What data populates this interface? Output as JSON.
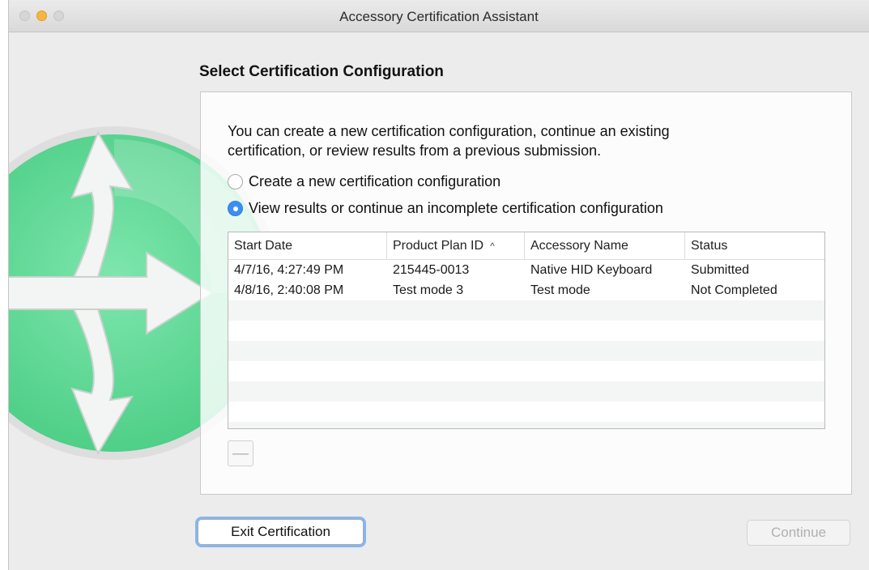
{
  "window": {
    "title": "Accessory Certification Assistant"
  },
  "page": {
    "heading": "Select Certification Configuration",
    "intro_line1": "You can create a new certification configuration, continue an existing",
    "intro_line2": "certification, or review results from a previous submission."
  },
  "options": {
    "create_label": "Create a new certification configuration",
    "view_label": "View results or continue an incomplete certification configuration",
    "selected": "view"
  },
  "table": {
    "columns": [
      "Start Date",
      "Product Plan ID",
      "Accessory Name",
      "Status"
    ],
    "sort_indicator": "^",
    "rows": [
      [
        "4/7/16, 4:27:49 PM",
        "215445-0013",
        "Native HID Keyboard",
        "Submitted"
      ],
      [
        "4/8/16, 2:40:08 PM",
        "Test mode 3",
        "Test mode",
        "Not Completed"
      ]
    ]
  },
  "controls": {
    "remove_label": "—",
    "exit_label": "Exit Certification",
    "continue_label": "Continue"
  },
  "colors": {
    "accent": "#3d8ef2",
    "logo_green": "#5fdb96"
  },
  "icons": {
    "logo": "split-arrows-icon"
  }
}
